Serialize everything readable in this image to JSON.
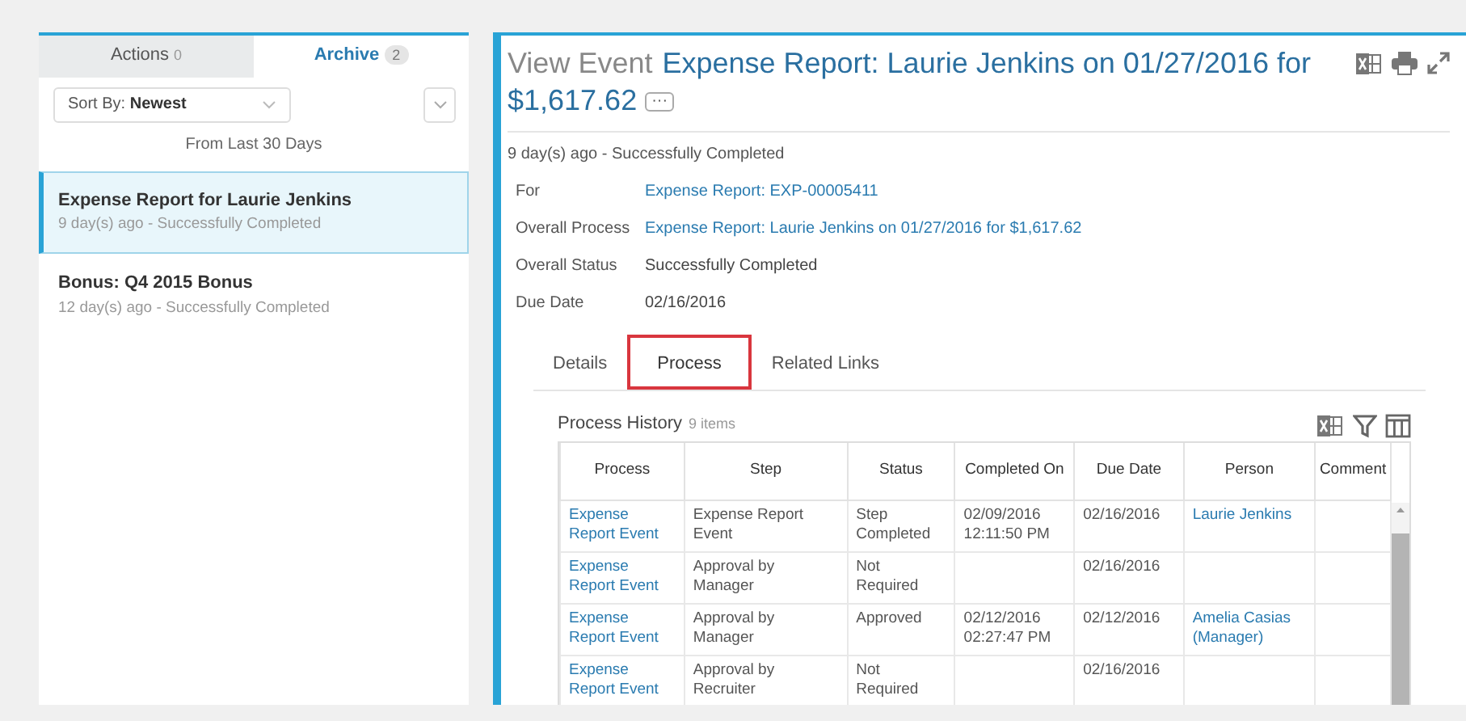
{
  "sidebar": {
    "tabs": [
      {
        "label": "Actions",
        "count": "0",
        "selected": false
      },
      {
        "label": "Archive",
        "count": "2",
        "selected": true
      }
    ],
    "sort": {
      "label": "Sort By:",
      "value": "Newest"
    },
    "range": "From Last 30 Days",
    "items": [
      {
        "title": "Expense Report for Laurie Jenkins",
        "subtitle": "9 day(s) ago - Successfully Completed",
        "selected": true
      },
      {
        "title": "Bonus: Q4 2015 Bonus",
        "subtitle": "12 day(s) ago - Successfully Completed",
        "selected": false
      }
    ]
  },
  "main": {
    "prefix": "View Event",
    "title": "Expense Report: Laurie Jenkins on 01/27/2016 for $1,617.62",
    "more": "···",
    "subtitle": "9 day(s) ago - Successfully Completed",
    "fields": [
      {
        "label": "For",
        "value": "Expense Report: EXP-00005411",
        "kind": "link"
      },
      {
        "label": "Overall Process",
        "value": "Expense Report: Laurie Jenkins on 01/27/2016 for $1,617.62",
        "kind": "link"
      },
      {
        "label": "Overall Status",
        "value": "Successfully Completed",
        "kind": "text"
      },
      {
        "label": "Due Date",
        "value": "02/16/2016",
        "kind": "text"
      }
    ],
    "tabs": [
      {
        "label": "Details",
        "selected": false,
        "highlighted": false
      },
      {
        "label": "Process",
        "selected": true,
        "highlighted": true
      },
      {
        "label": "Related Links",
        "selected": false,
        "highlighted": false
      }
    ],
    "history": {
      "title": "Process History",
      "count": "9 items",
      "columns": [
        {
          "label": "Process",
          "kind": "link"
        },
        {
          "label": "Step",
          "kind": "text"
        },
        {
          "label": "Status",
          "kind": "text"
        },
        {
          "label": "Completed On",
          "kind": "text"
        },
        {
          "label": "Due Date",
          "kind": "text"
        },
        {
          "label": "Person",
          "kind": "link"
        },
        {
          "label": "Comment",
          "kind": "text"
        }
      ],
      "rows": [
        [
          "Expense Report Event",
          "Expense Report Event",
          "Step Completed",
          "02/09/2016 12:11:50 PM",
          "02/16/2016",
          "Laurie Jenkins",
          ""
        ],
        [
          "Expense Report Event",
          "Approval by Manager",
          "Not Required",
          "",
          "02/16/2016",
          "",
          ""
        ],
        [
          "Expense Report Event",
          "Approval by Manager",
          "Approved",
          "02/12/2016 02:27:47 PM",
          "02/12/2016",
          "Amelia Casias (Manager)",
          ""
        ],
        [
          "Expense Report Event",
          "Approval by Recruiter",
          "Not Required",
          "",
          "02/16/2016",
          "",
          ""
        ]
      ]
    }
  }
}
